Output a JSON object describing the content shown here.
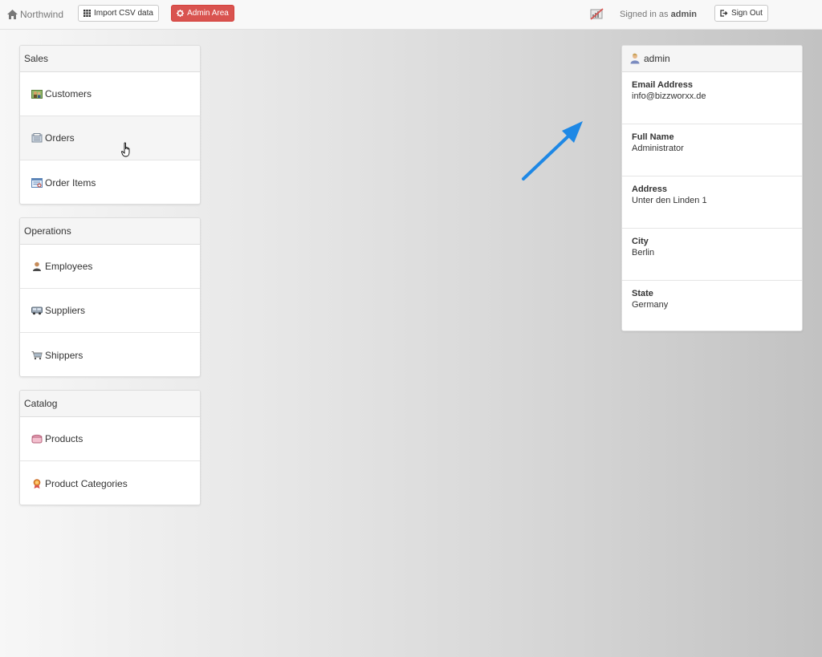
{
  "nav": {
    "brand": "Northwind",
    "import_label": "Import CSV data",
    "admin_label": "Admin Area",
    "signed_in_prefix": "Signed in as",
    "username": "admin",
    "signout_label": "Sign Out"
  },
  "groups": [
    {
      "title": "Sales",
      "items": [
        {
          "label": "Customers",
          "icon": "customers-icon"
        },
        {
          "label": "Orders",
          "icon": "orders-icon"
        },
        {
          "label": "Order Items",
          "icon": "order-items-icon"
        }
      ]
    },
    {
      "title": "Operations",
      "items": [
        {
          "label": "Employees",
          "icon": "employees-icon"
        },
        {
          "label": "Suppliers",
          "icon": "suppliers-icon"
        },
        {
          "label": "Shippers",
          "icon": "shippers-icon"
        }
      ]
    },
    {
      "title": "Catalog",
      "items": [
        {
          "label": "Products",
          "icon": "products-icon"
        },
        {
          "label": "Product Categories",
          "icon": "product-categories-icon"
        }
      ]
    }
  ],
  "profile": {
    "title": "admin",
    "fields": [
      {
        "label": "Email Address",
        "value": "info@bizzworxx.de"
      },
      {
        "label": "Full Name",
        "value": "Administrator"
      },
      {
        "label": "Address",
        "value": "Unter den Linden 1"
      },
      {
        "label": "City",
        "value": "Berlin"
      },
      {
        "label": "State",
        "value": "Germany"
      }
    ]
  },
  "colors": {
    "danger": "#d9534f",
    "arrow": "#1e88e5"
  }
}
